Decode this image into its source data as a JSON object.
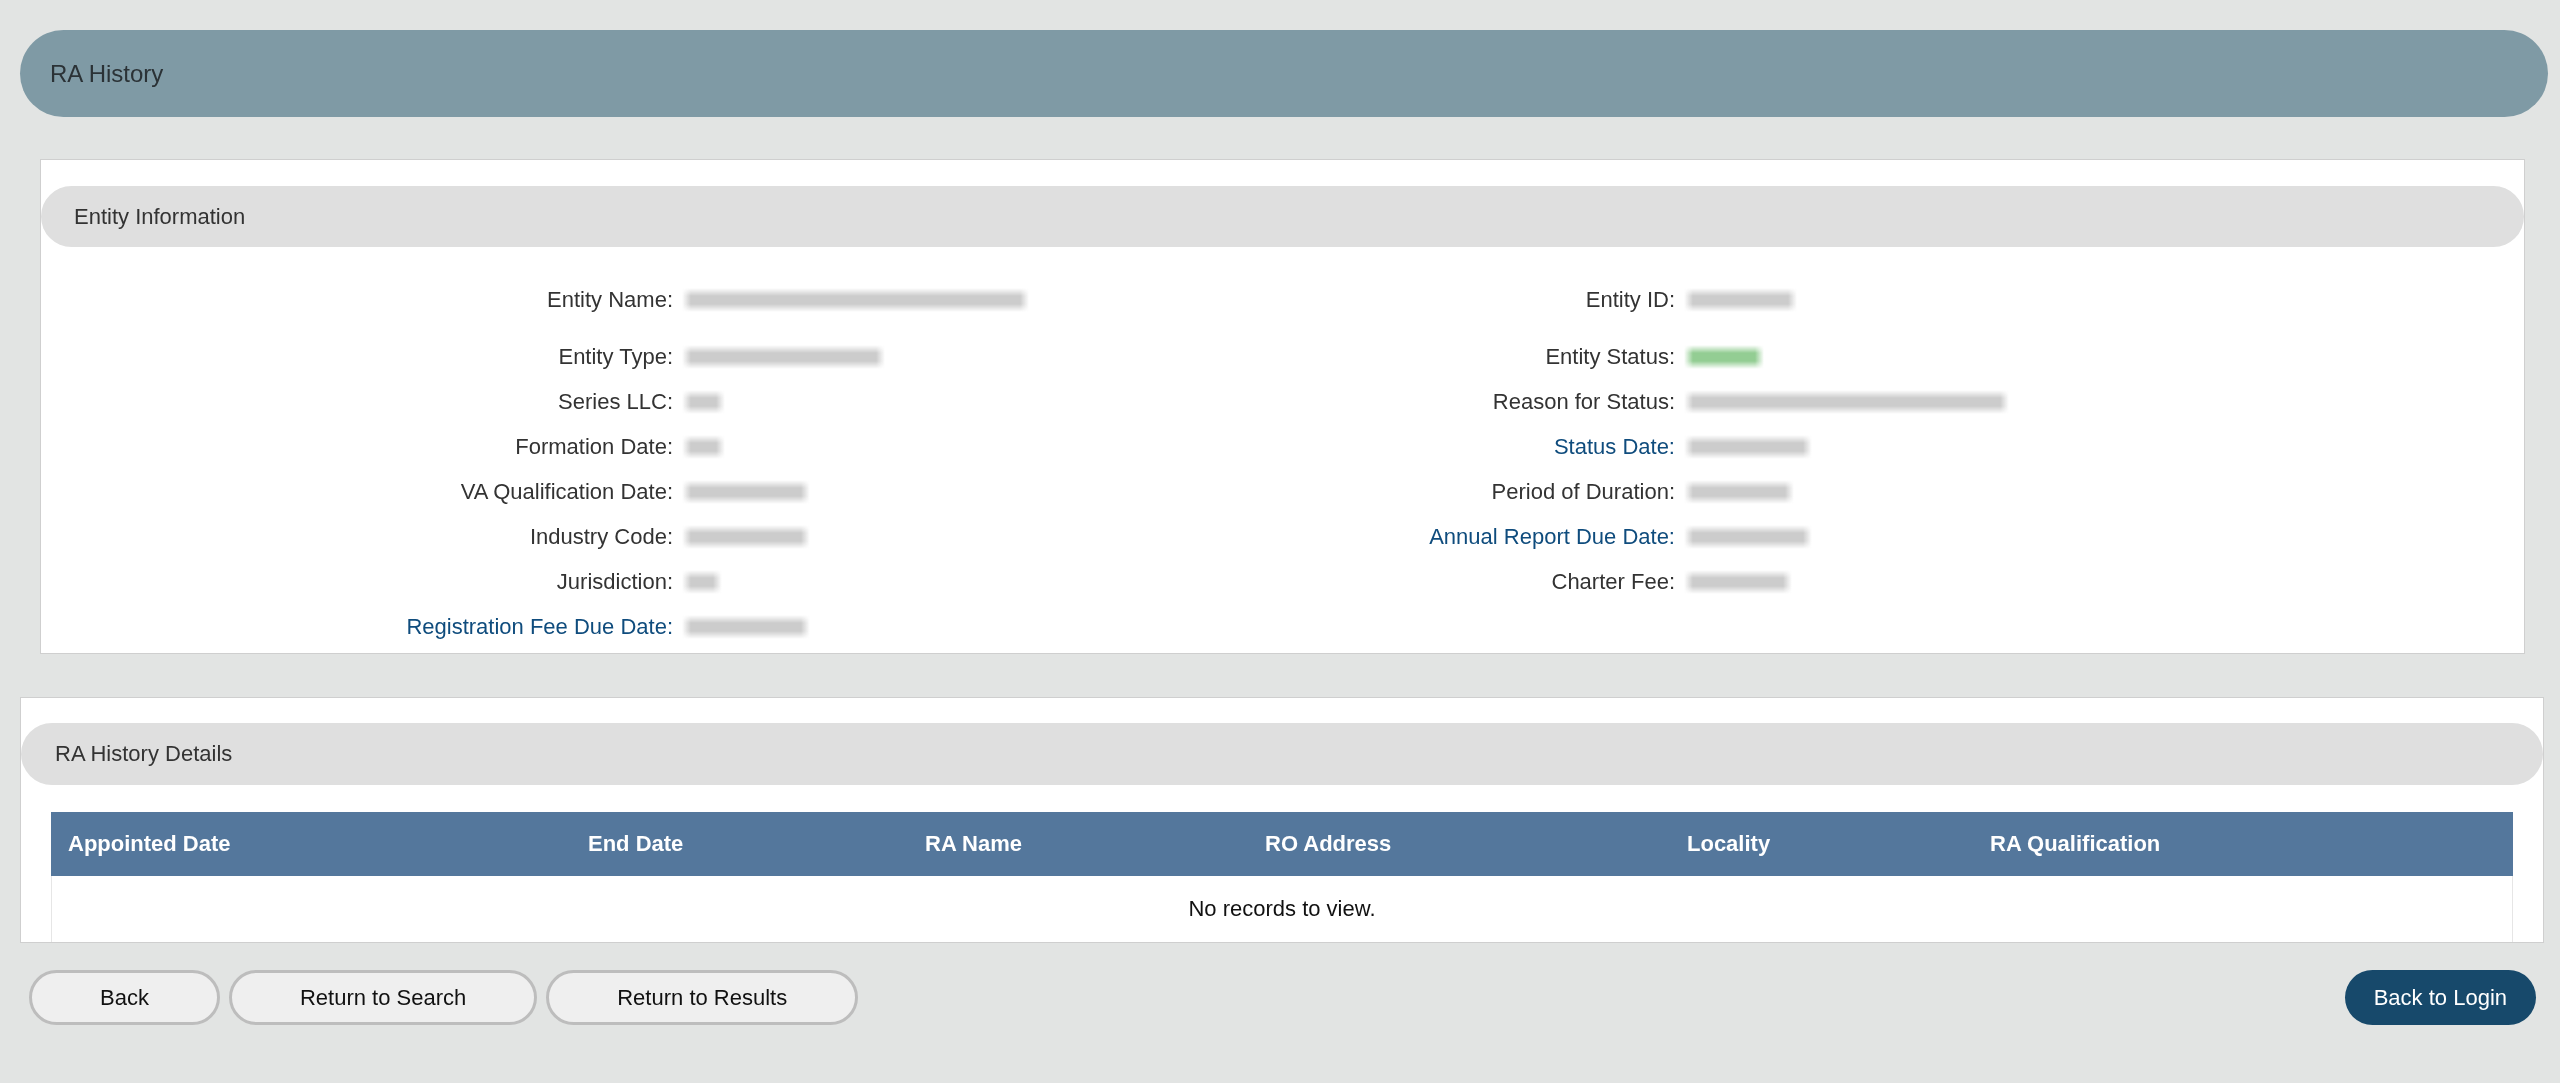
{
  "page": {
    "title": "RA History"
  },
  "entity_information": {
    "title": "Entity Information",
    "left": [
      {
        "label": "Entity Name:",
        "link": false,
        "value_blurred": true
      },
      {
        "label": "Entity Type:",
        "link": false,
        "value_blurred": true
      },
      {
        "label": "Series LLC:",
        "link": false,
        "value_blurred": true
      },
      {
        "label": "Formation Date:",
        "link": false,
        "value_blurred": true
      },
      {
        "label": "VA Qualification Date:",
        "link": false,
        "value_blurred": true
      },
      {
        "label": "Industry Code:",
        "link": false,
        "value_blurred": true
      },
      {
        "label": "Jurisdiction:",
        "link": false,
        "value_blurred": true
      },
      {
        "label": "Registration Fee Due Date:",
        "link": true,
        "value_blurred": true
      }
    ],
    "right": [
      {
        "label": "Entity ID:",
        "link": false,
        "value_blurred": true
      },
      {
        "label": "Entity Status:",
        "link": false,
        "value_blurred": true,
        "color": "#93cd93"
      },
      {
        "label": "Reason for Status:",
        "link": false,
        "value_blurred": true
      },
      {
        "label": "Status Date:",
        "link": true,
        "value_blurred": true
      },
      {
        "label": "Period of Duration:",
        "link": false,
        "value_blurred": true
      },
      {
        "label": "Annual Report Due Date:",
        "link": true,
        "value_blurred": true
      },
      {
        "label": "Charter Fee:",
        "link": false,
        "value_blurred": true
      }
    ]
  },
  "ra_history_details": {
    "title": "RA History Details",
    "table": {
      "columns": [
        "Appointed Date",
        "End Date",
        "RA Name",
        "RO Address",
        "Locality",
        "RA Qualification"
      ],
      "empty_message": "No records to view."
    }
  },
  "buttons": [
    {
      "label": "Back",
      "kind": "secondary"
    },
    {
      "label": "Return to Search",
      "kind": "secondary"
    },
    {
      "label": "Return to Results",
      "kind": "secondary"
    },
    {
      "label": "Back to Login",
      "kind": "primary"
    }
  ]
}
